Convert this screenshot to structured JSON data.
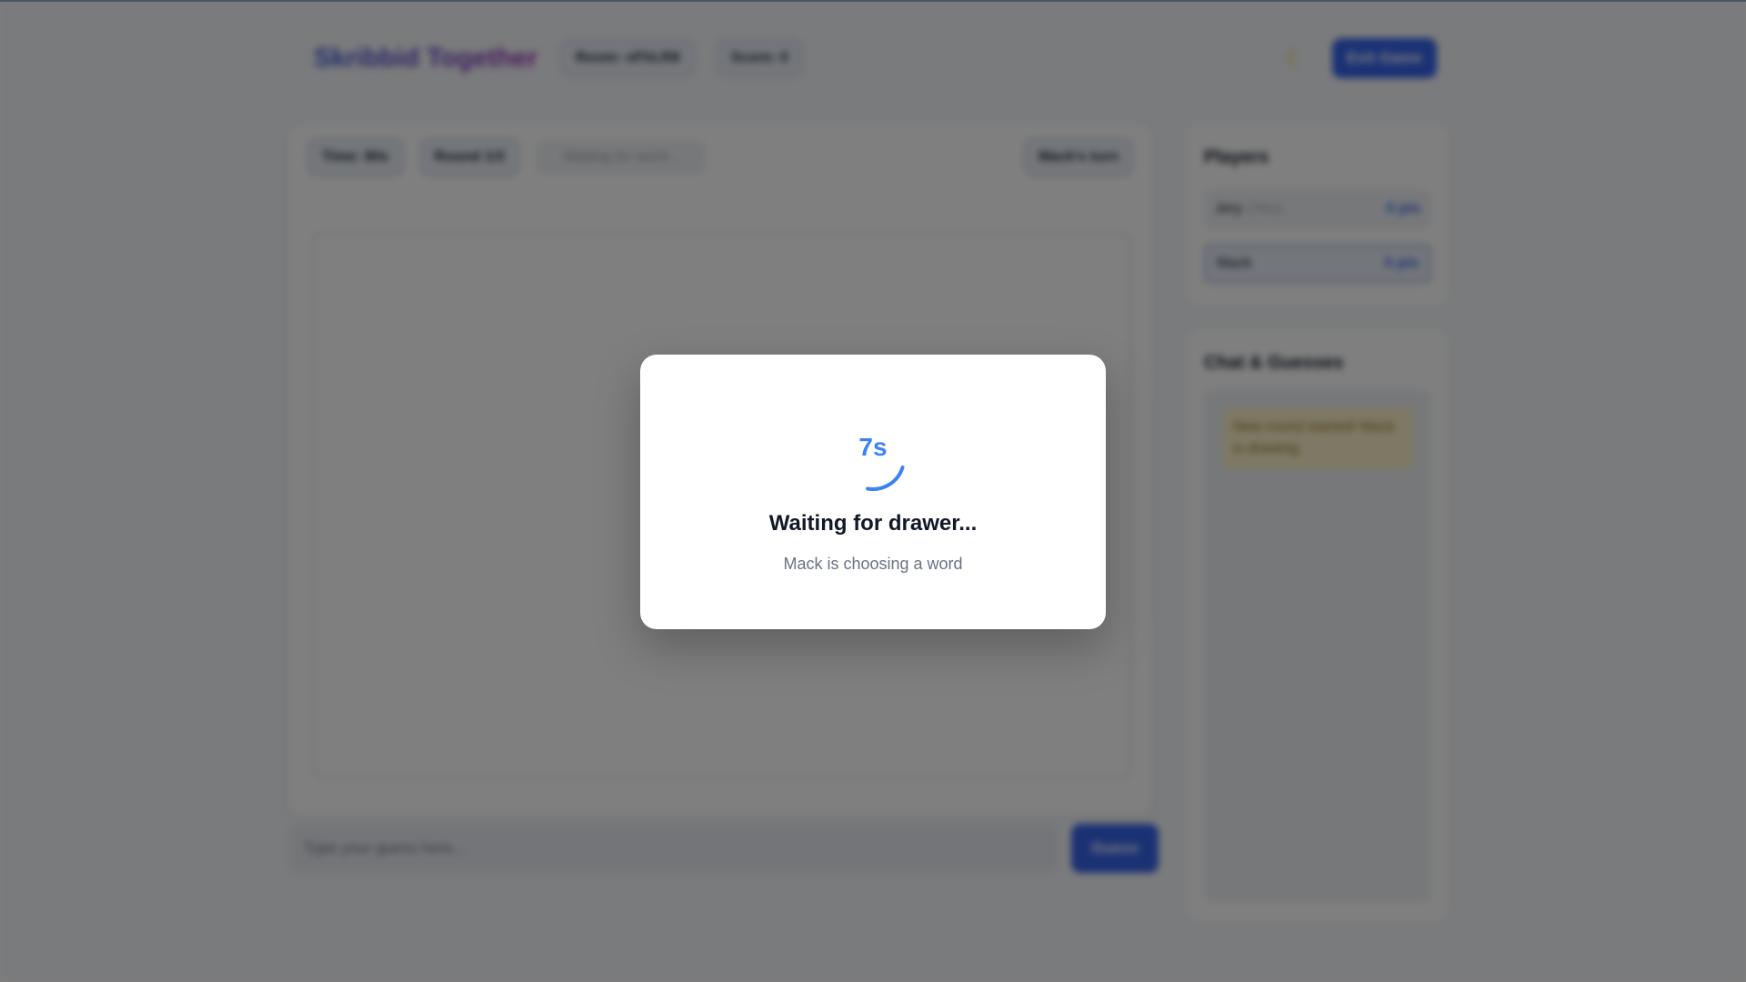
{
  "header": {
    "title": "Skribbid Together",
    "room_label": "Room: nFhLR8",
    "score_label": "Score: 0",
    "theme_icon": "moon-icon",
    "exit_label": "Exit Game"
  },
  "game": {
    "time_label": "Time: 80s",
    "round_label": "Round 1/3",
    "word_hint": "Waiting for word...",
    "turn_label": "Mack's turn"
  },
  "guess": {
    "placeholder": "Type your guess here...",
    "send_label": "Guess"
  },
  "players": {
    "title": "Players",
    "items": [
      {
        "name": "Jery",
        "tag": "(You)",
        "points": "0 pts"
      },
      {
        "name": "Mack",
        "tag": "",
        "points": "0 pts"
      }
    ]
  },
  "chat": {
    "title": "Chat & Guesses",
    "system_message": "New round started! Mack is drawing."
  },
  "modal": {
    "countdown": "7s",
    "countdown_fraction": 0.23,
    "title": "Waiting for drawer...",
    "subtitle": "Mack is choosing a word"
  },
  "colors": {
    "accent": "#3b82f6",
    "primary_button": "#3563e9",
    "overlay": "rgba(0,0,0,0.5)"
  }
}
